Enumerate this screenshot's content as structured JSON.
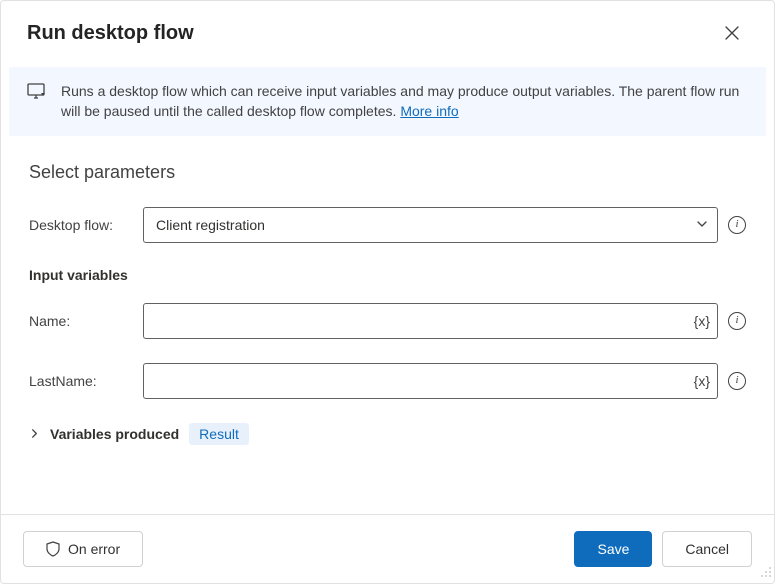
{
  "header": {
    "title": "Run desktop flow"
  },
  "banner": {
    "text": "Runs a desktop flow which can receive input variables and may produce output variables. The parent flow run will be paused until the called desktop flow completes. ",
    "more_link": "More info"
  },
  "parameters": {
    "heading": "Select parameters",
    "desktop_flow": {
      "label": "Desktop flow:",
      "value": "Client registration"
    },
    "input_vars_heading": "Input variables",
    "inputs": {
      "name": {
        "label": "Name:",
        "value": ""
      },
      "lastname": {
        "label": "LastName:",
        "value": ""
      }
    },
    "variables_produced": {
      "label": "Variables produced",
      "pill": "Result"
    }
  },
  "buttons": {
    "on_error": "On error",
    "save": "Save",
    "cancel": "Cancel"
  },
  "icons": {
    "variable_token": "{x}",
    "info": "i"
  }
}
